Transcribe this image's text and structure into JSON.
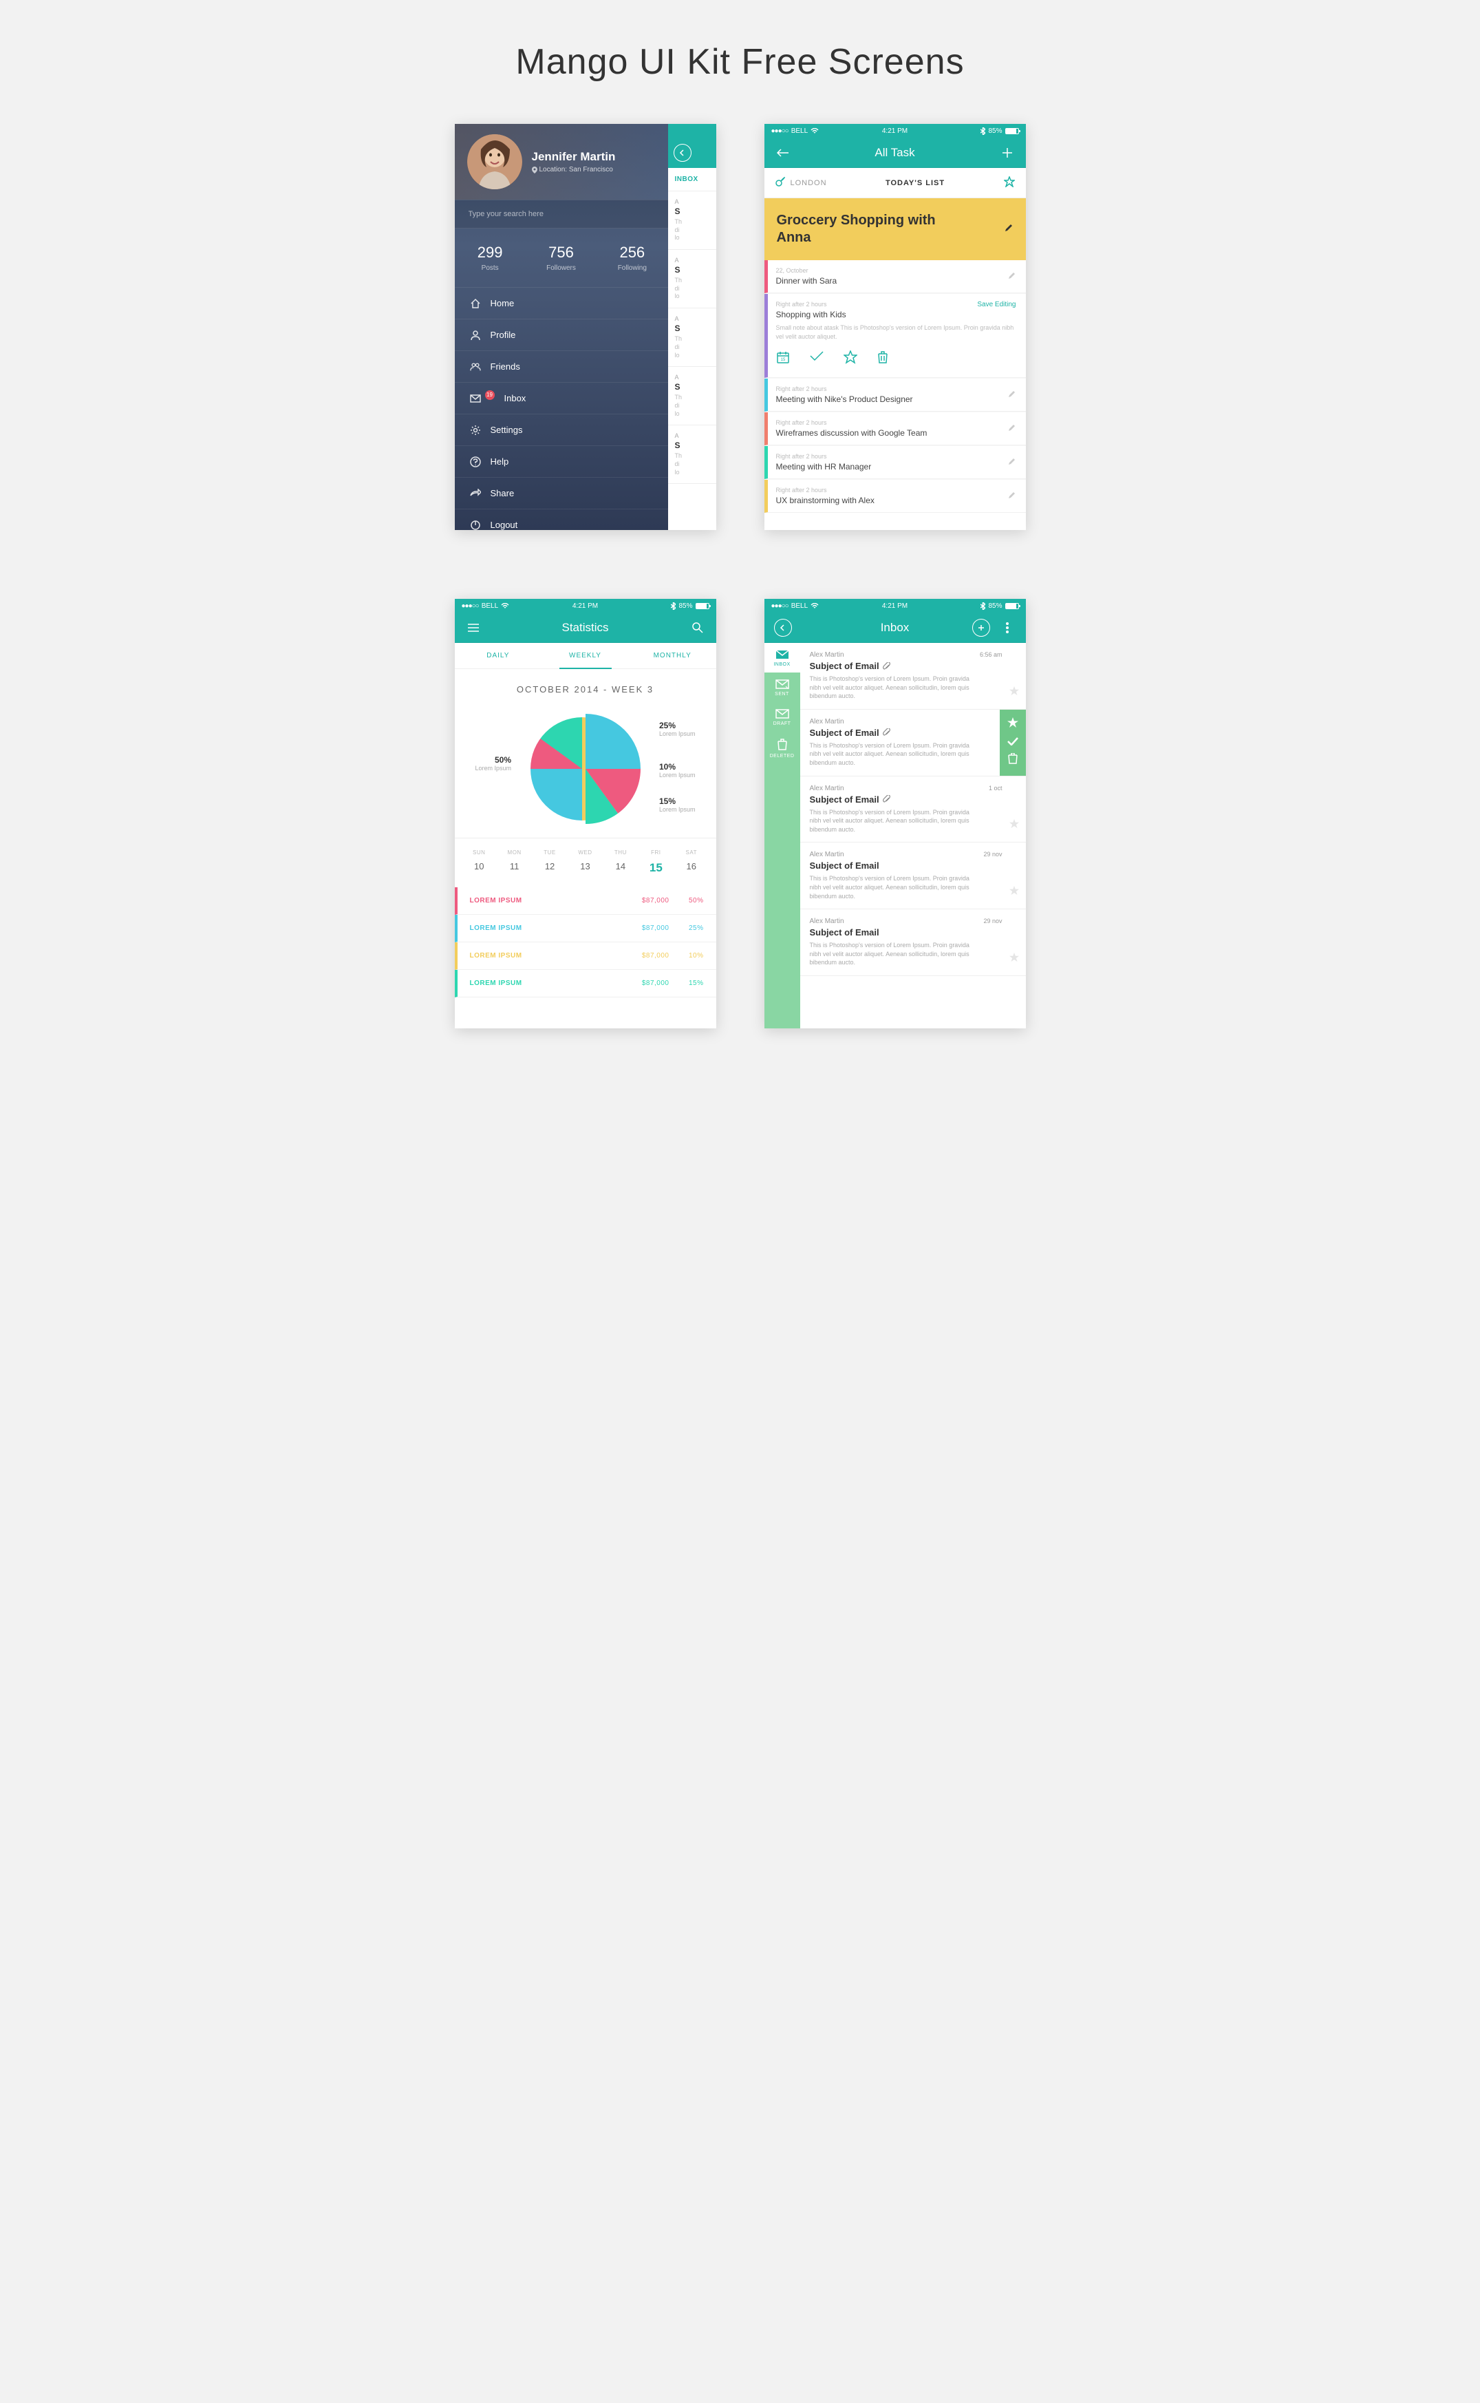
{
  "page_title": "Mango UI Kit Free Screens",
  "status": {
    "carrier": "BELL",
    "time": "4:21 PM",
    "battery": "85%"
  },
  "drawer": {
    "name": "Jennifer Martin",
    "location_label": "Location: San Francisco",
    "search_placeholder": "Type your search here",
    "stats": [
      {
        "num": "299",
        "label": "Posts"
      },
      {
        "num": "756",
        "label": "Followers"
      },
      {
        "num": "256",
        "label": "Following"
      }
    ],
    "menu": [
      {
        "label": "Home"
      },
      {
        "label": "Profile"
      },
      {
        "label": "Friends"
      },
      {
        "label": "Inbox",
        "badge": "19"
      },
      {
        "label": "Settings"
      },
      {
        "label": "Help"
      },
      {
        "label": "Share"
      },
      {
        "label": "Logout"
      }
    ],
    "peek_tab": "INBOX",
    "peek_sender_initial": "A",
    "peek_subject_initial": "S",
    "peek_text_initial": "Th\ndi\nlo"
  },
  "tasks": {
    "title": "All Task",
    "city": "LONDON",
    "today": "TODAY'S LIST",
    "feature": "Groccery Shopping with Anna",
    "items": [
      {
        "color": "#ee5a7f",
        "meta": "22, October",
        "title": "Dinner with Sara"
      },
      {
        "color": "#9c7fd8",
        "meta": "Right after 2 hours",
        "title": "Shopping with Kids",
        "expanded": true,
        "save": "Save Editing",
        "note": "Small note about atask This is Photoshop's version  of Lorem Ipsum. Proin gravida nibh vel velit auctor aliquet."
      },
      {
        "color": "#45c8e0",
        "meta": "Right after 2 hours",
        "title": "Meeting with Nike's Product Designer"
      },
      {
        "color": "#f07f6e",
        "meta": "Right after 2 hours",
        "title": "Wireframes discussion with Google Team"
      },
      {
        "color": "#2dd6b0",
        "meta": "Right after 2 hours",
        "title": "Meeting with HR Manager"
      },
      {
        "color": "#f2cd5c",
        "meta": "Right after 2 hours",
        "title": "UX brainstorming with Alex"
      }
    ]
  },
  "stats": {
    "title": "Statistics",
    "tabs": [
      "DAILY",
      "WEEKLY",
      "MONTHLY"
    ],
    "active_tab": 1,
    "heading": "OCTOBER 2014  -  WEEK 3",
    "lorem": "Lorem Ipsum",
    "days": [
      {
        "name": "SUN",
        "num": "10"
      },
      {
        "name": "MON",
        "num": "11"
      },
      {
        "name": "TUE",
        "num": "12"
      },
      {
        "name": "WED",
        "num": "13"
      },
      {
        "name": "THU",
        "num": "14"
      },
      {
        "name": "FRI",
        "num": "15",
        "selected": true
      },
      {
        "name": "SAT",
        "num": "16"
      }
    ],
    "rows": [
      {
        "color": "#ee5a7f",
        "name": "LOREM IPSUM",
        "val": "$87,000",
        "pct": "50%"
      },
      {
        "color": "#45c8e0",
        "name": "LOREM IPSUM",
        "val": "$87,000",
        "pct": "25%"
      },
      {
        "color": "#f2cd5c",
        "name": "LOREM IPSUM",
        "val": "$87,000",
        "pct": "10%"
      },
      {
        "color": "#2dd6b0",
        "name": "LOREM IPSUM",
        "val": "$87,000",
        "pct": "15%"
      }
    ]
  },
  "chart_data": {
    "type": "pie",
    "title": "OCTOBER 2014  -  WEEK 3",
    "series": [
      {
        "name": "Lorem Ipsum",
        "value": 50,
        "color": "#f2cd5c"
      },
      {
        "name": "Lorem Ipsum",
        "value": 25,
        "color": "#45c8e0"
      },
      {
        "name": "Lorem Ipsum",
        "value": 10,
        "color": "#ee5a7f"
      },
      {
        "name": "Lorem Ipsum",
        "value": 15,
        "color": "#2dd6b0"
      }
    ],
    "labels": [
      "50%",
      "25%",
      "10%",
      "15%"
    ]
  },
  "inbox": {
    "title": "Inbox",
    "side": [
      {
        "label": "INBOX"
      },
      {
        "label": "SENT"
      },
      {
        "label": "DRAFT"
      },
      {
        "label": "DELETED"
      }
    ],
    "mails": [
      {
        "from": "Alex Martin",
        "subject": "Subject of Email",
        "attach": true,
        "time": "6:56 am",
        "preview": "This is Photoshop's version  of Lorem Ipsum. Proin gravida nibh vel velit auctor aliquet. Aenean sollicitudin, lorem quis bibendum aucto."
      },
      {
        "from": "Alex Martin",
        "subject": "Subject of Email",
        "attach": true,
        "time": "",
        "preview": "This is Photoshop's version  of Lorem Ipsum. Proin gravida nibh vel velit auctor aliquet. Aenean sollicitudin, lorem quis bibendum aucto.",
        "selected": true
      },
      {
        "from": "Alex Martin",
        "subject": "Subject of Email",
        "attach": true,
        "time": "1 oct",
        "preview": "This is Photoshop's version  of Lorem Ipsum. Proin gravida nibh vel velit auctor aliquet. Aenean sollicitudin, lorem quis bibendum aucto."
      },
      {
        "from": "Alex Martin",
        "subject": "Subject of Email",
        "attach": false,
        "time": "29 nov",
        "preview": "This is Photoshop's version  of Lorem Ipsum. Proin gravida nibh vel velit auctor aliquet. Aenean sollicitudin, lorem quis bibendum aucto."
      },
      {
        "from": "Alex Martin",
        "subject": "Subject of Email",
        "attach": false,
        "time": "29 nov",
        "preview": "This is Photoshop's version  of Lorem Ipsum. Proin gravida nibh vel velit auctor aliquet. Aenean sollicitudin, lorem quis bibendum aucto."
      }
    ]
  }
}
